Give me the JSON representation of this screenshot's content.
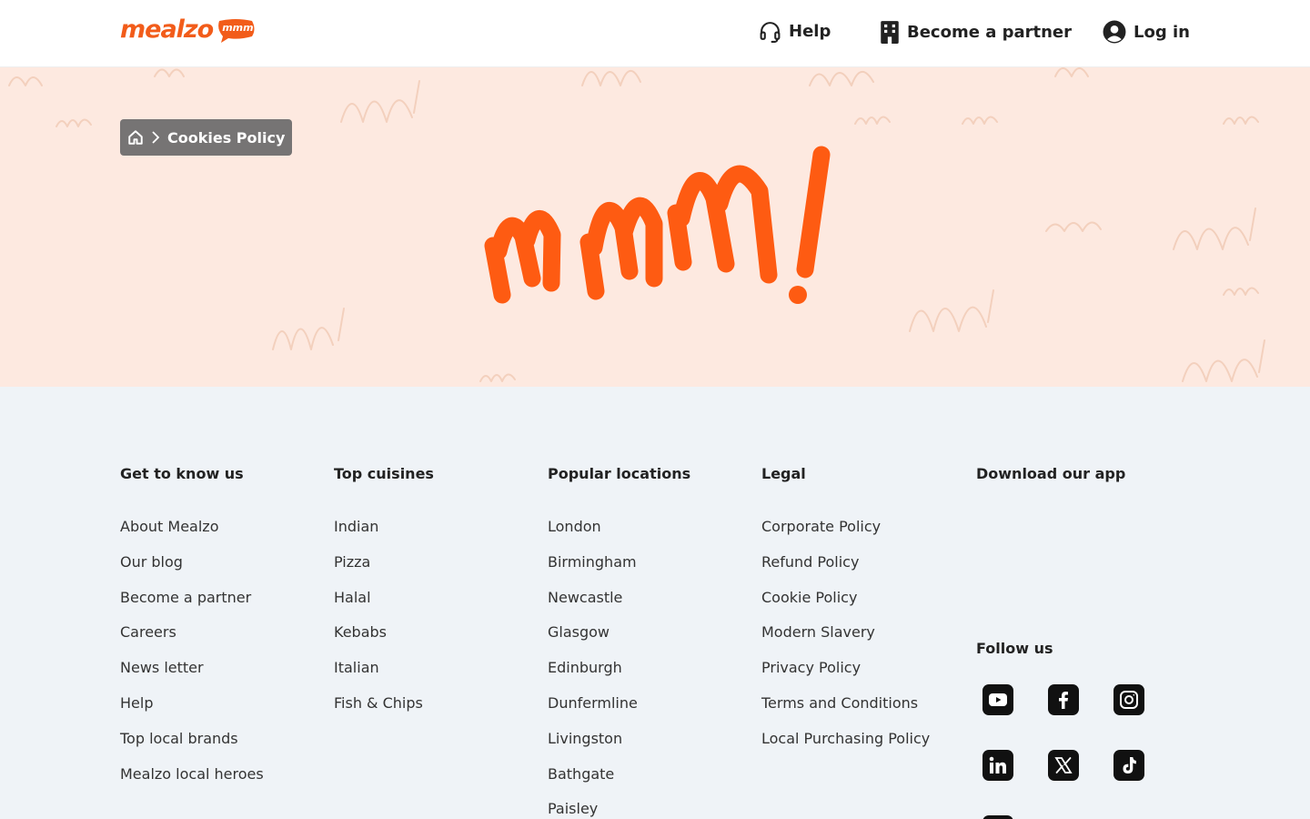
{
  "header": {
    "logo_text": "mealzo",
    "logo_bubble_text": "mmm!",
    "nav": {
      "help": "Help",
      "partner": "Become a partner",
      "login": "Log in"
    }
  },
  "breadcrumb": {
    "current": "Cookies Policy"
  },
  "footer": {
    "columns": [
      {
        "heading": "Get to know us",
        "links": [
          "About Mealzo",
          "Our blog",
          "Become a partner",
          "Careers",
          "News letter",
          "Help",
          "Top local brands",
          "Mealzo local heroes"
        ]
      },
      {
        "heading": "Top cuisines",
        "links": [
          "Indian",
          "Pizza",
          "Halal",
          "Kebabs",
          "Italian",
          "Fish & Chips"
        ]
      },
      {
        "heading": "Popular locations",
        "links": [
          "London",
          "Birmingham",
          "Newcastle",
          "Glasgow",
          "Edinburgh",
          "Dunfermline",
          "Livingston",
          "Bathgate",
          "Paisley"
        ]
      },
      {
        "heading": "Legal",
        "links": [
          "Corporate Policy",
          "Refund Policy",
          "Cookie Policy",
          "Modern Slavery",
          "Privacy Policy",
          "Terms and Conditions",
          "Local Purchasing Policy"
        ]
      },
      {
        "heading": "Download our app",
        "links": []
      }
    ],
    "follow_heading": "Follow us",
    "social": [
      "youtube-icon",
      "facebook-icon",
      "instagram-icon",
      "linkedin-icon",
      "x-icon",
      "tiktok-icon"
    ]
  },
  "colors": {
    "brand": "#f25c1a",
    "hero_bg": "#fde9e0",
    "footer_bg": "#eff3f7",
    "breadcrumb_bg": "#767474"
  }
}
